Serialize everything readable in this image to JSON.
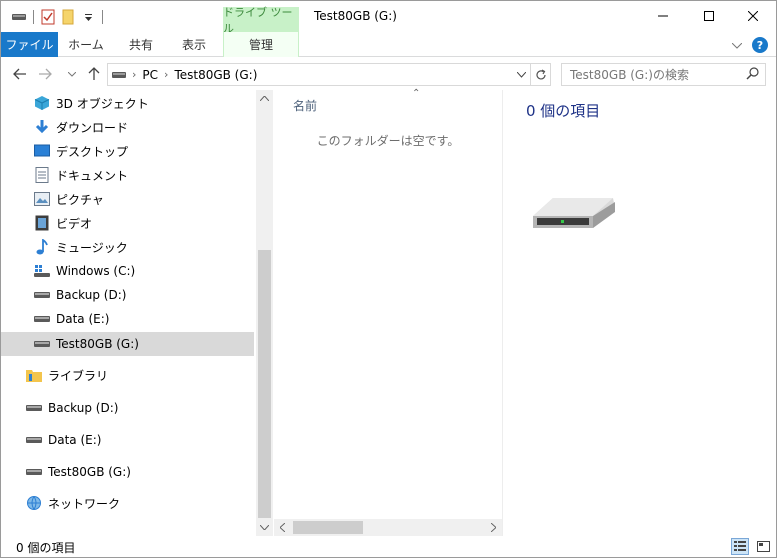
{
  "window": {
    "title": "Test80GB (G:)",
    "contextual_tab_header": "ドライブ ツール"
  },
  "ribbon": {
    "tabs": {
      "file": "ファイル",
      "home": "ホーム",
      "share": "共有",
      "view": "表示",
      "manage": "管理"
    },
    "help_glyph": "?"
  },
  "address": {
    "crumbs": [
      "PC",
      "Test80GB (G:)"
    ],
    "search_placeholder": "Test80GB (G:)の検索"
  },
  "nav_pane": {
    "items": [
      {
        "label": "3D オブジェクト",
        "icon": "3d-objects-icon"
      },
      {
        "label": "ダウンロード",
        "icon": "downloads-icon"
      },
      {
        "label": "デスクトップ",
        "icon": "desktop-icon"
      },
      {
        "label": "ドキュメント",
        "icon": "documents-icon"
      },
      {
        "label": "ピクチャ",
        "icon": "pictures-icon"
      },
      {
        "label": "ビデオ",
        "icon": "videos-icon"
      },
      {
        "label": "ミュージック",
        "icon": "music-icon"
      },
      {
        "label": "Windows (C:)",
        "icon": "windows-drive-icon"
      },
      {
        "label": "Backup (D:)",
        "icon": "drive-icon"
      },
      {
        "label": "Data (E:)",
        "icon": "drive-icon"
      },
      {
        "label": "Test80GB (G:)",
        "icon": "drive-icon",
        "selected": true
      }
    ],
    "root_items": [
      {
        "label": "ライブラリ",
        "icon": "libraries-icon"
      },
      {
        "label": "Backup (D:)",
        "icon": "drive-icon"
      },
      {
        "label": "Data (E:)",
        "icon": "drive-icon"
      },
      {
        "label": "Test80GB (G:)",
        "icon": "drive-icon"
      },
      {
        "label": "ネットワーク",
        "icon": "network-icon"
      }
    ]
  },
  "content": {
    "column_name": "名前",
    "empty_message": "このフォルダーは空です。"
  },
  "details_pane": {
    "item_count": "0 個の項目"
  },
  "status_bar": {
    "item_count": "0 個の項目"
  },
  "colors": {
    "file_tab": "#1979ca",
    "drive_tools": "#c8f1c8",
    "selection": "#d9d9d9",
    "details_title": "#1e3287"
  }
}
